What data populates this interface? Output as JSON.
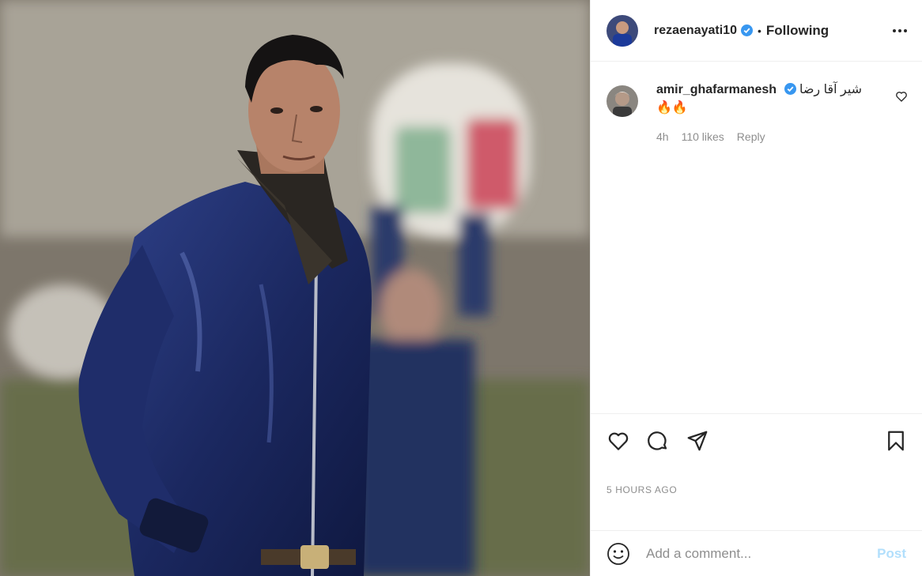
{
  "post": {
    "image_alt": "Man in navy jacket and scarf at a football match, official holding substitution board in background"
  },
  "header": {
    "username": "rezaenayati10",
    "verified": true,
    "separator": "•",
    "follow_state": "Following",
    "more_icon": "more-options-icon"
  },
  "comments": [
    {
      "username": "amir_ghafarmanesh",
      "verified": true,
      "text": "شیر آقا رضا",
      "emoji": "🔥🔥",
      "time": "4h",
      "likes": "110 likes",
      "reply": "Reply"
    }
  ],
  "actions": {
    "like": "heart-icon",
    "comment": "comment-icon",
    "share": "share-icon",
    "save": "bookmark-icon"
  },
  "timestamp": "5 HOURS AGO",
  "add_comment": {
    "placeholder": "Add a comment...",
    "post_label": "Post",
    "emoji_icon": "smiley-icon"
  },
  "colors": {
    "verified": "#3897f0",
    "post_disabled": "#b2dffc",
    "muted": "#8e8e8e"
  }
}
